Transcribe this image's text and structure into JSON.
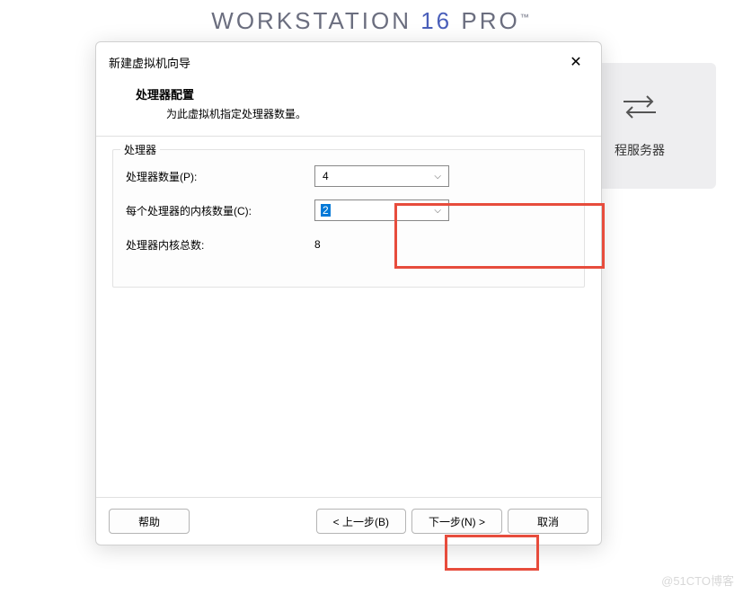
{
  "background": {
    "title_prefix": "WORKSTATION ",
    "title_num": "16",
    "title_suffix": " PRO",
    "card_label": "程服务器"
  },
  "dialog": {
    "title": "新建虚拟机向导",
    "header_title": "处理器配置",
    "header_subtitle": "为此虚拟机指定处理器数量。",
    "fieldset_legend": "处理器",
    "rows": {
      "proc_count_label": "处理器数量(P):",
      "proc_count_value": "4",
      "cores_per_label": "每个处理器的内核数量(C):",
      "cores_per_value": "2",
      "total_label": "处理器内核总数:",
      "total_value": "8"
    },
    "buttons": {
      "help": "帮助",
      "back": "< 上一步(B)",
      "next": "下一步(N) >",
      "cancel": "取消"
    }
  },
  "watermark": "@51CTO博客"
}
